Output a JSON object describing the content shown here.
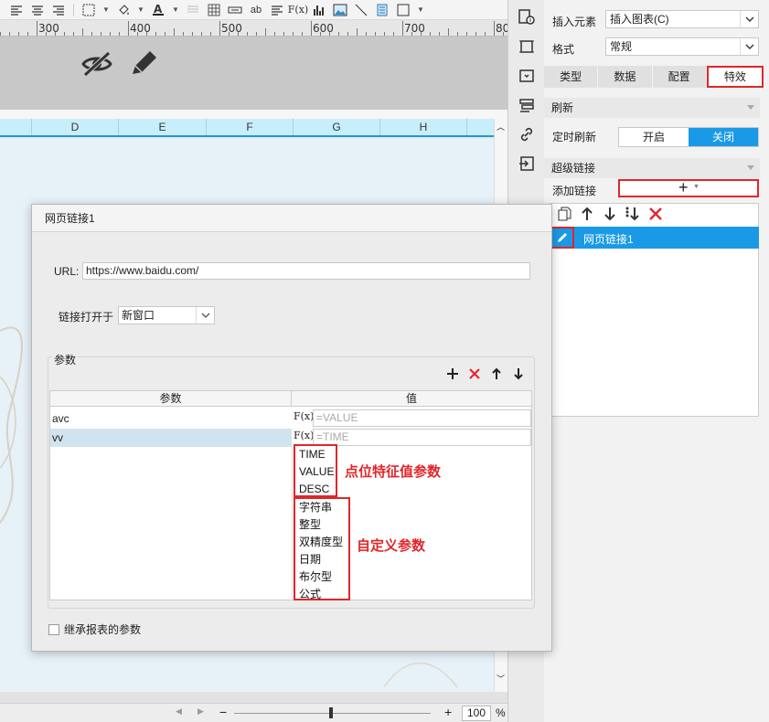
{
  "ruler": {
    "marks": [
      "300",
      "400",
      "500",
      "600",
      "700",
      "80"
    ]
  },
  "columns": [
    "D",
    "E",
    "F",
    "G",
    "H"
  ],
  "zoom": {
    "value": "100",
    "unit": "%",
    "minus": "−",
    "plus": "+"
  },
  "right_panel": {
    "insert_label": "插入元素",
    "insert_value": "插入图表(C)",
    "format_label": "格式",
    "format_value": "常规",
    "tabs": [
      "类型",
      "数据",
      "配置",
      "特效"
    ],
    "active_tab": "特效",
    "refresh_section": "刷新",
    "timed_refresh_label": "定时刷新",
    "toggle_on": "开启",
    "toggle_off": "关闭",
    "hyperlink_section": "超级链接",
    "add_link_label": "添加链接",
    "add_link_symbol": "+",
    "link_item": "网页链接1"
  },
  "dialog": {
    "title": "网页链接1",
    "url_label": "URL:",
    "url_value": "https://www.baidu.com/",
    "open_in_label": "链接打开于",
    "open_in_value": "新窗口",
    "params_label": "参数",
    "table_headers": [
      "参数",
      "值"
    ],
    "rows": [
      {
        "name": "avc",
        "value": "=VALUE",
        "selected": false
      },
      {
        "name": "vv",
        "value": "=TIME",
        "selected": true
      }
    ],
    "fx_label": "F(x)",
    "dropdown_feature": [
      "TIME",
      "VALUE",
      "DESC"
    ],
    "dropdown_custom": [
      "字符串",
      "整型",
      "双精度型",
      "日期",
      "布尔型",
      "公式"
    ],
    "annotation_feature": "点位特征值参数",
    "annotation_custom": "自定义参数",
    "inherit_label": "继承报表的参数"
  },
  "colors": {
    "accent": "#1a9ae6",
    "annotation_red": "#e0262a",
    "header_blue": "#c9eefb"
  }
}
